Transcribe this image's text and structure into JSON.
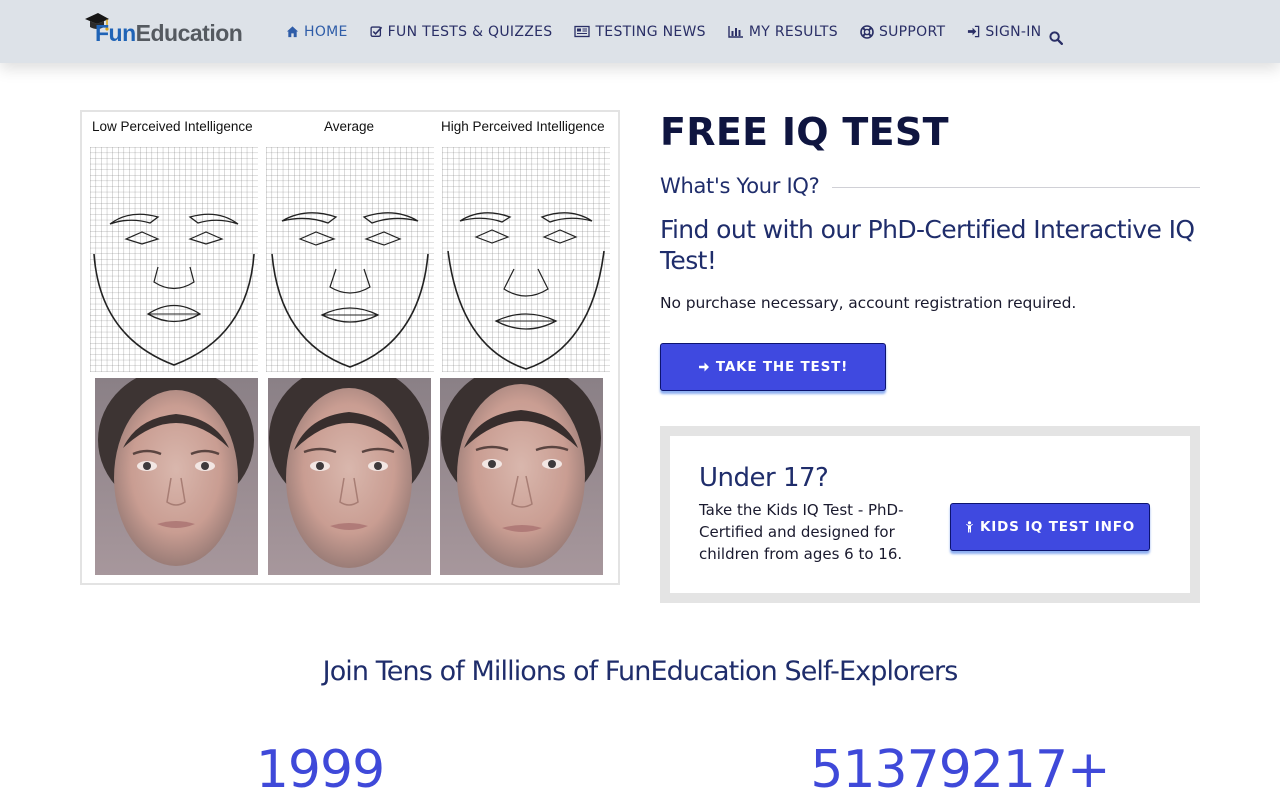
{
  "nav": {
    "logo_part1": "Fun",
    "logo_part2": "Education",
    "items": [
      {
        "label": "HOME",
        "icon": "home-icon",
        "active": true
      },
      {
        "label": "FUN TESTS & QUIZZES",
        "icon": "check-square-icon",
        "active": false
      },
      {
        "label": "TESTING NEWS",
        "icon": "newspaper-icon",
        "active": false
      },
      {
        "label": "MY RESULTS",
        "icon": "bar-chart-icon",
        "active": false
      },
      {
        "label": "SUPPORT",
        "icon": "life-ring-icon",
        "active": false
      },
      {
        "label": "SIGN-IN",
        "icon": "sign-in-icon",
        "active": false
      }
    ],
    "search_icon": "search-icon"
  },
  "hero": {
    "labels": [
      "Low Perceived Intelligence",
      "Average",
      "High Perceived Intelligence"
    ],
    "title": "FREE IQ TEST",
    "subtitle": "What's Your IQ?",
    "tagline": "Find out with our PhD-Certified Interactive IQ Test!",
    "disclaimer": "No purchase necessary, account registration required.",
    "cta_label": "TAKE THE TEST!",
    "cta_icon": "arrow-right-icon"
  },
  "kids": {
    "title": "Under 17?",
    "text": "Take the Kids IQ Test - PhD-Certified and designed for children from ages 6 to 16.",
    "button_label": "KIDS IQ TEST INFO",
    "button_icon": "child-icon"
  },
  "stats": {
    "heading": "Join Tens of Millions of FunEducation Self-Explorers",
    "left_value": "1999",
    "right_value": "51379217+"
  },
  "colors": {
    "navbar_bg": "#dde2e8",
    "nav_text": "#2a2f66",
    "nav_active": "#2f5da8",
    "primary_button": "#3f49e0",
    "heading_dark": "#0f1540",
    "heading_blue": "#1f2d6b",
    "stat_blue": "#3f49d9"
  }
}
